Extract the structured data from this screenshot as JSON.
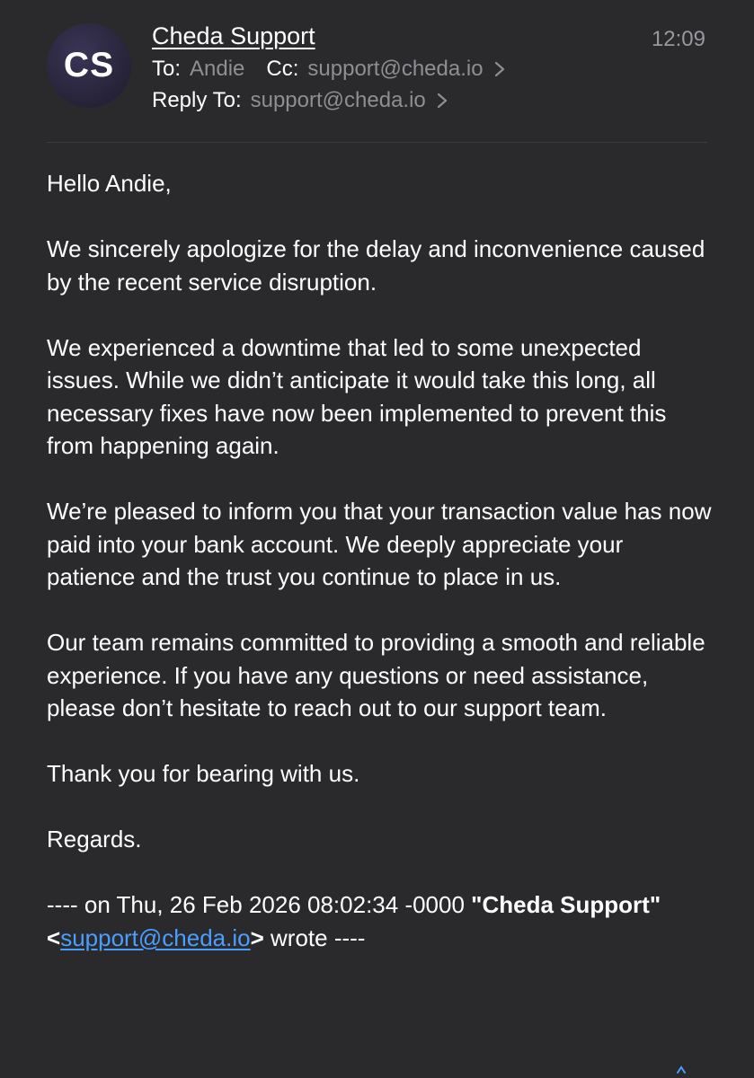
{
  "email": {
    "avatar_initials": "CS",
    "sender_name": "Cheda Support",
    "time": "12:09",
    "to_label": "To:",
    "to_value": "Andie",
    "cc_label": "Cc:",
    "cc_value": "support@cheda.io",
    "reply_to_label": "Reply To:",
    "reply_to_value": "support@cheda.io",
    "accent_color": "#4a9eff"
  },
  "body": {
    "paragraphs": [
      "Hello Andie,",
      "We sincerely apologize for the delay and inconvenience caused by the recent service disruption.",
      "We experienced a downtime that led to some unexpected issues. While we didn’t anticipate it would take this long, all necessary fixes have now been implemented to prevent this from happening again.",
      "We’re pleased to inform you that your transaction value has now paid into your bank account. We deeply appreciate your patience and the trust you continue to place in us.",
      "Our team remains committed to providing a smooth and reliable experience. If you have any questions or need assistance, please don’t hesitate to reach out to our support team.",
      "Thank you for bearing with us.",
      "Regards."
    ],
    "quote_prefix": "---- on Thu, 26 Feb 2026 08:02:34 -0000 ",
    "quote_sender": "\"Cheda Support\"",
    "quote_lt": "<",
    "quote_email": "support@cheda.io",
    "quote_gt": ">",
    "quote_suffix": " wrote ----"
  },
  "icons": {
    "cc_chevron": "chevron-right-icon",
    "reply_chevron": "chevron-right-icon"
  }
}
